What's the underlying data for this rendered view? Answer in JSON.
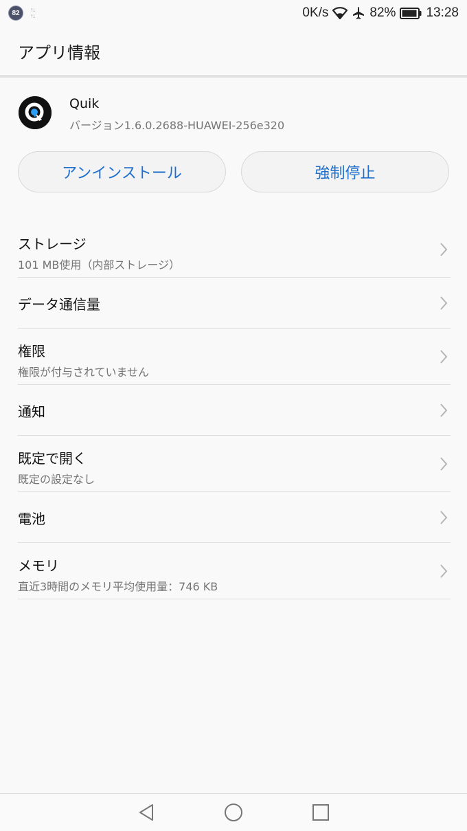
{
  "status_bar": {
    "notification_count": "82",
    "network_speed": "0K/s",
    "battery_percent": "82%",
    "time": "13:28",
    "icons": [
      "wifi-icon",
      "airplane-icon",
      "battery-icon"
    ]
  },
  "header": {
    "title": "アプリ情報"
  },
  "app": {
    "name": "Quik",
    "version": "バージョン1.6.0.2688-HUAWEI-256e320",
    "icon": "quik-app-icon"
  },
  "buttons": {
    "uninstall": "アンインストール",
    "force_stop": "強制停止",
    "accent_color": "#1f6fcc"
  },
  "list": [
    {
      "title": "ストレージ",
      "subtitle": "101 MB使用（内部ストレージ）"
    },
    {
      "title": "データ通信量",
      "subtitle": ""
    },
    {
      "title": "権限",
      "subtitle": "権限が付与されていません"
    },
    {
      "title": "通知",
      "subtitle": ""
    },
    {
      "title": "既定で開く",
      "subtitle": "既定の設定なし"
    },
    {
      "title": "電池",
      "subtitle": ""
    },
    {
      "title": "メモリ",
      "subtitle": "直近3時間のメモリ平均使用量：746 KB"
    }
  ],
  "nav_bar": {
    "icons": [
      "back-icon",
      "home-icon",
      "recents-icon"
    ]
  }
}
